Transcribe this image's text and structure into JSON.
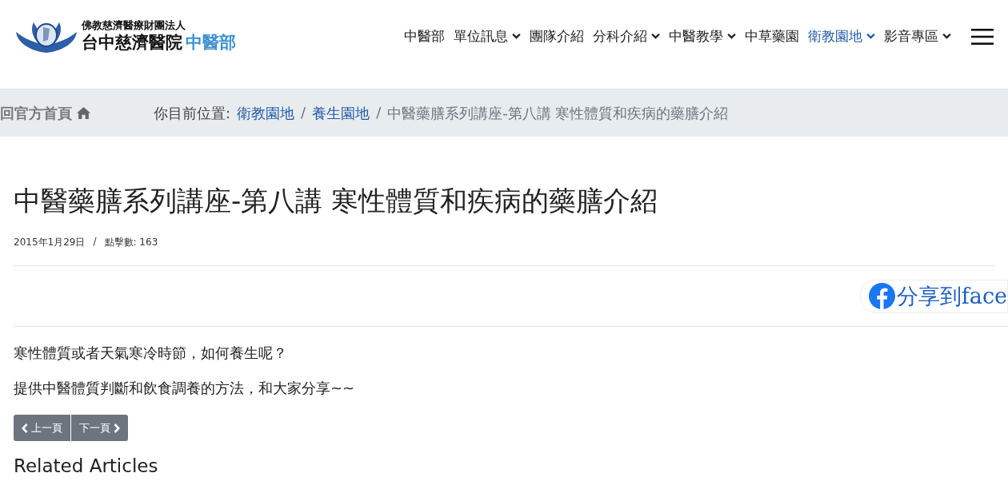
{
  "logo": {
    "org": "佛教慈濟醫療財團法人",
    "name": "台中慈濟醫院",
    "dept": "中醫部"
  },
  "nav": [
    {
      "label": "中醫部",
      "dropdown": false,
      "selected": false
    },
    {
      "label": "單位訊息",
      "dropdown": true,
      "selected": false
    },
    {
      "label": "團隊介紹",
      "dropdown": false,
      "selected": false
    },
    {
      "label": "分科介紹",
      "dropdown": true,
      "selected": false
    },
    {
      "label": "中醫教學",
      "dropdown": true,
      "selected": false
    },
    {
      "label": "中草藥園",
      "dropdown": false,
      "selected": false
    },
    {
      "label": "衛教園地",
      "dropdown": true,
      "selected": true
    },
    {
      "label": "影音專區",
      "dropdown": true,
      "selected": false
    }
  ],
  "home_link": "回官方首頁",
  "breadcrumb": {
    "prefix": "你目前位置:",
    "separators": [
      "/",
      "/"
    ],
    "links": [
      "衛教園地",
      "養生園地"
    ],
    "current": "中醫藥膳系列講座-第八講 寒性體質和疾病的藥膳介紹"
  },
  "article": {
    "title": "中醫藥膳系列講座-第八講 寒性體質和疾病的藥膳介紹",
    "date": "2015年1月29日",
    "meta_separator": "/",
    "hits": "點擊數: 163",
    "share": "分享到face",
    "paragraphs": [
      "寒性體質或者天氣寒冷時節，如何養生呢？",
      "提供中醫體質判斷和飲食調養的方法，和大家分享~~"
    ]
  },
  "pager": {
    "prev": "上一頁",
    "next": "下一頁"
  },
  "related_heading": "Related Articles"
}
